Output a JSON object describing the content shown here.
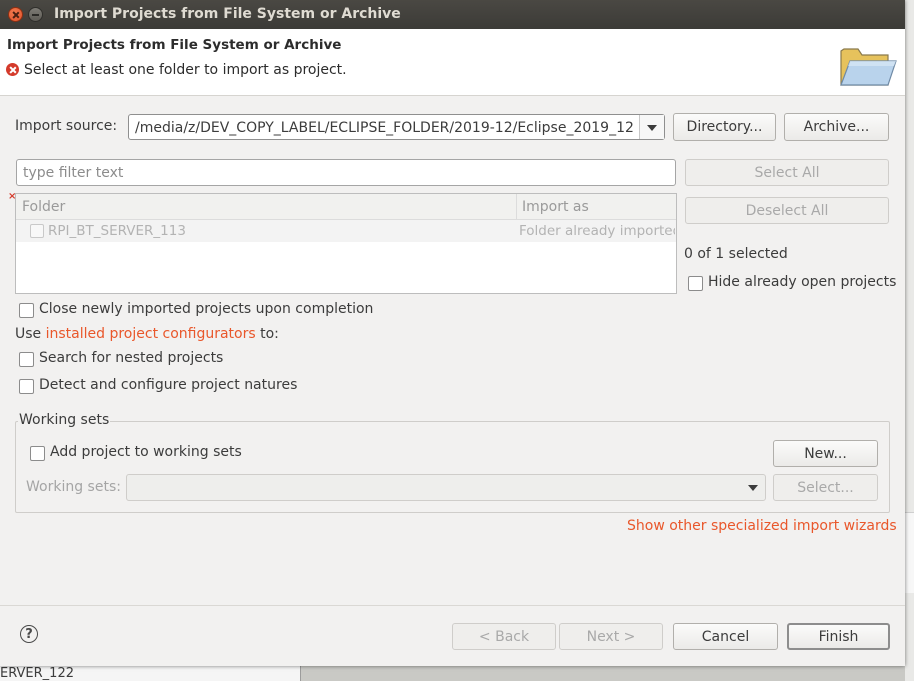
{
  "window": {
    "title": "Import Projects from File System or Archive"
  },
  "header": {
    "title": "Import Projects from File System or Archive",
    "message": "Select at least one folder to import as project.",
    "icon": "folder-icon"
  },
  "import_source": {
    "label": "Import source:",
    "value": "/media/z/DEV_COPY_LABEL/ECLIPSE_FOLDER/2019-12/Eclipse_2019_12",
    "directory_button": "Directory...",
    "archive_button": "Archive..."
  },
  "filter": {
    "placeholder": "type filter text",
    "value": ""
  },
  "buttons": {
    "select_all": "Select All",
    "deselect_all": "Deselect All"
  },
  "table": {
    "columns": [
      "Folder",
      "Import as"
    ],
    "rows": [
      {
        "folder": "RPI_BT_SERVER_113",
        "import_as": "Folder already imported",
        "checked": false
      }
    ]
  },
  "selection_count": "0 of 1 selected",
  "hide_open": {
    "label": "Hide already open projects",
    "checked": false
  },
  "close_newly": {
    "label": "Close newly imported projects upon completion",
    "checked": false
  },
  "configurators": {
    "prefix": "Use ",
    "link": "installed project configurators",
    "suffix": " to:"
  },
  "nested": {
    "label": "Search for nested projects",
    "checked": false
  },
  "natures": {
    "label": "Detect and configure project natures",
    "checked": false
  },
  "working_sets": {
    "group_title": "Working sets",
    "add_label": "Add project to working sets",
    "add_checked": false,
    "new_button": "New...",
    "sets_label": "Working sets:",
    "sets_value": "",
    "select_button": "Select..."
  },
  "other_wizards_link": "Show other specialized import wizards",
  "footer": {
    "back": "< Back",
    "next": "Next >",
    "cancel": "Cancel",
    "finish": "Finish"
  },
  "background": {
    "fragment_text": "ERVER_122"
  },
  "colors": {
    "link": "#e9572b",
    "error": "#d43a2b",
    "titlebar": "#3c3b37"
  }
}
